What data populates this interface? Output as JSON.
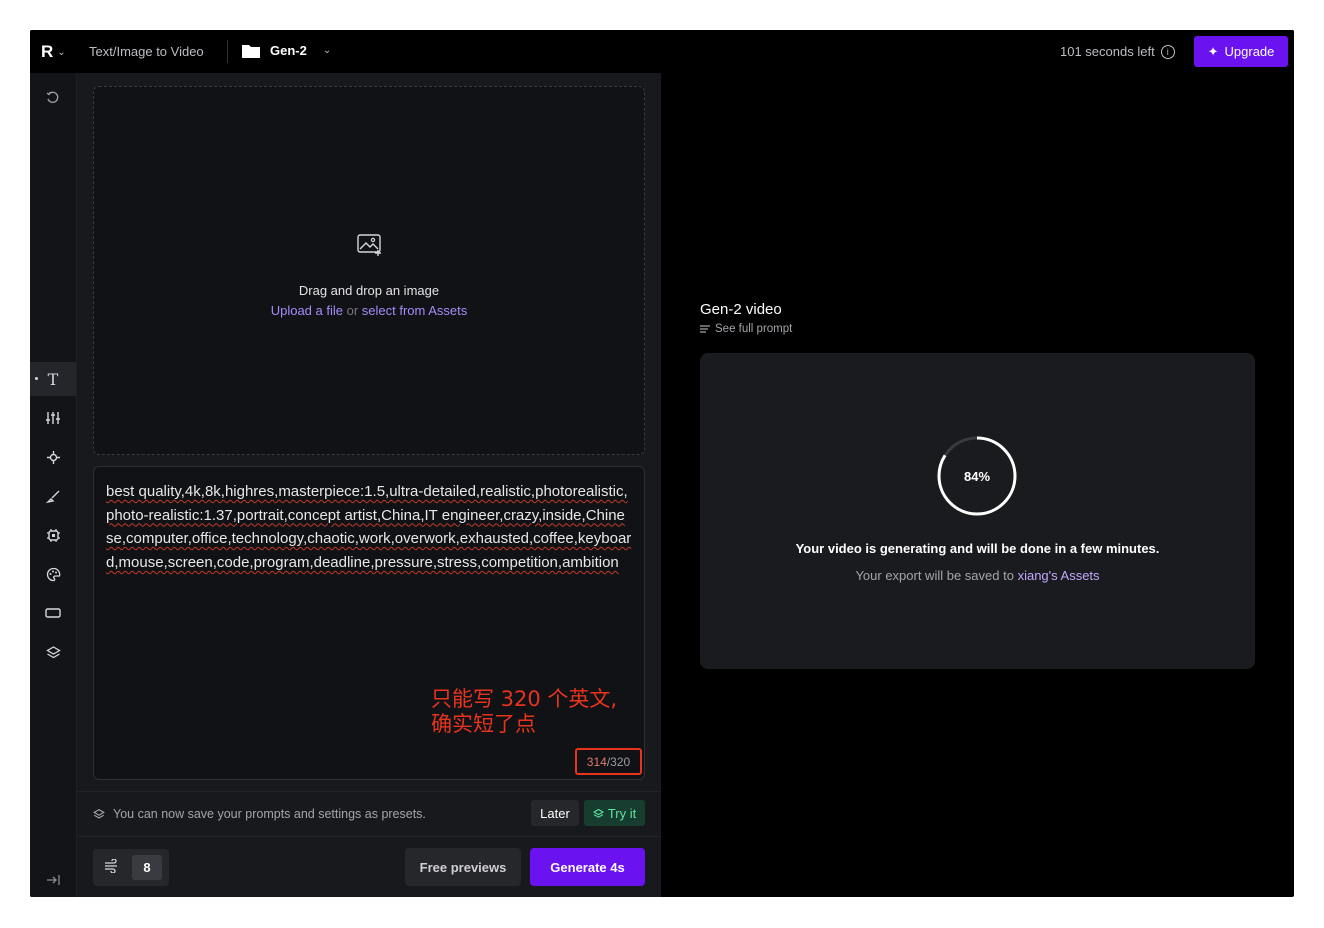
{
  "topbar": {
    "logo": "R",
    "breadcrumb": "Text/Image to Video",
    "folder_name": "Gen-2",
    "time_left": "101 seconds left",
    "upgrade_label": "Upgrade"
  },
  "rail": {
    "items": [
      "history-icon",
      "text-icon",
      "sliders-icon",
      "camera-motion-icon",
      "brush-icon",
      "settings-chip-icon",
      "palette-icon",
      "aspect-ratio-icon",
      "layers-icon",
      "collapse-icon"
    ],
    "active_item": "text-icon"
  },
  "dropzone": {
    "title": "Drag and drop an image",
    "upload_label": "Upload a file",
    "or_label": "or",
    "assets_label": "select from Assets"
  },
  "prompt": {
    "text": "best quality,4k,8k,highres,masterpiece:1.5,ultra-detailed,realistic,photorealistic,photo-realistic:1.37,portrait,concept artist,China,IT engineer,crazy,inside,Chinese,computer,office,technology,chaotic,work,overwork,exhausted,coffee,keyboard,mouse,screen,code,program,deadline,pressure,stress,competition,ambition",
    "annotation_line1": "只能写 320 个英文,",
    "annotation_line2": "确实短了点",
    "char_count": "314",
    "char_limit": "/320"
  },
  "presets": {
    "message": "You can now save your prompts and settings as presets.",
    "later_label": "Later",
    "try_label": "Try it"
  },
  "bottom": {
    "seed_value": "8",
    "free_previews_label": "Free previews",
    "generate_label": "Generate 4s"
  },
  "output": {
    "title": "Gen-2 video",
    "see_prompt_label": "See full prompt",
    "progress_percent": 84,
    "progress_label": "84%",
    "status_message": "Your video is generating and will be done in a few minutes.",
    "export_prefix": "Your export will be saved to",
    "export_link": "xiang's Assets"
  },
  "colors": {
    "accent": "#6b12f0",
    "annotation_red": "#e8331d",
    "link_purple": "#a78bfa"
  }
}
